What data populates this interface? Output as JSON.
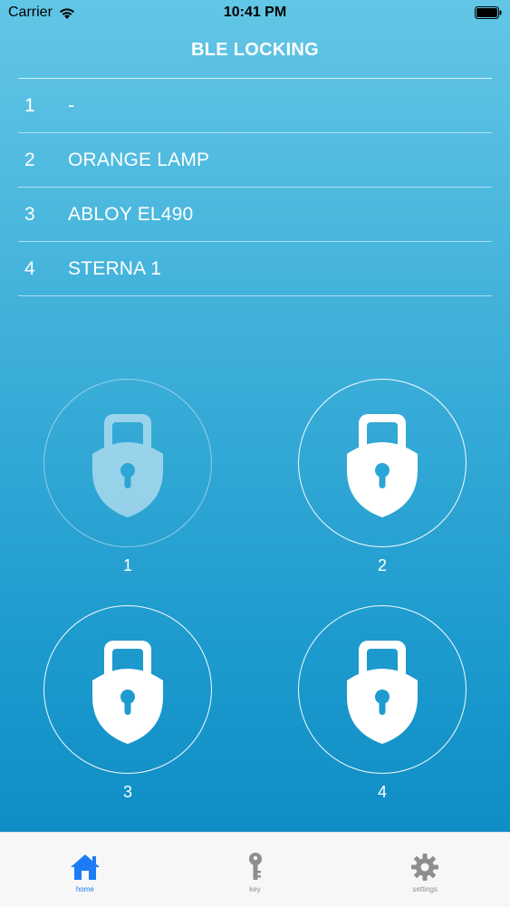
{
  "status_bar": {
    "carrier": "Carrier",
    "time": "10:41 PM",
    "wifi_icon": "wifi-icon",
    "battery_icon": "battery-icon"
  },
  "header": {
    "title": "BLE LOCKING"
  },
  "devices": [
    {
      "index": "1",
      "name": "-"
    },
    {
      "index": "2",
      "name": "ORANGE LAMP"
    },
    {
      "index": "3",
      "name": "ABLOY EL490"
    },
    {
      "index": "4",
      "name": "STERNA 1"
    }
  ],
  "locks": [
    {
      "label": "1",
      "icon": "lock-icon",
      "state": "dimmed"
    },
    {
      "label": "2",
      "icon": "lock-icon",
      "state": "normal"
    },
    {
      "label": "3",
      "icon": "lock-icon",
      "state": "normal"
    },
    {
      "label": "4",
      "icon": "lock-icon",
      "state": "normal"
    }
  ],
  "tab_bar": {
    "tabs": [
      {
        "label": "home",
        "icon": "home-icon",
        "active": true
      },
      {
        "label": "key",
        "icon": "key-icon",
        "active": false
      },
      {
        "label": "settings",
        "icon": "gear-icon",
        "active": false
      }
    ]
  },
  "colors": {
    "background_top": "#62c6e6",
    "background_bottom": "#0f8ec6",
    "tab_active": "#1c7cf6",
    "tab_inactive": "#8e8e8e"
  }
}
